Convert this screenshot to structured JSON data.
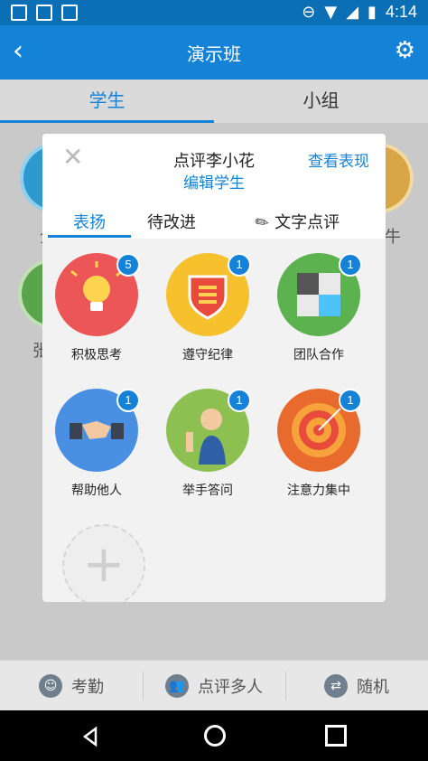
{
  "status_bar": {
    "time": "4:14",
    "icons": [
      "image-icon",
      "n-icon",
      "download-icon",
      "do-not-disturb-icon",
      "wifi-icon",
      "signal-icon",
      "battery-icon"
    ]
  },
  "app_bar": {
    "title": "演示班"
  },
  "tabs": [
    {
      "label": "学生"
    },
    {
      "label": "小组"
    }
  ],
  "background": {
    "partial_texts": [
      "全",
      "张",
      "牛"
    ]
  },
  "modal": {
    "student_title": "点评李小花",
    "edit_student": "编辑学生",
    "view_performance": "查看表现",
    "tabs": [
      {
        "label": "表扬"
      },
      {
        "label": "待改进"
      },
      {
        "label": "文字点评"
      }
    ],
    "items": [
      {
        "label": "积极思考",
        "badge": "5"
      },
      {
        "label": "遵守纪律",
        "badge": "1"
      },
      {
        "label": "团队合作",
        "badge": "1"
      },
      {
        "label": "帮助他人",
        "badge": "1"
      },
      {
        "label": "举手答问",
        "badge": "1"
      },
      {
        "label": "注意力集中",
        "badge": "1"
      }
    ],
    "add_symbol": "+"
  },
  "bottom_bar": {
    "attendance": "考勤",
    "review_multiple": "点评多人",
    "random": "随机"
  },
  "colors": {
    "primary": "#1483d7",
    "status_bar": "#0a6fb4",
    "red": "#ec5656",
    "yellow": "#f6c12c",
    "green": "#5cb24f",
    "blue": "#4a90e2",
    "lime": "#8cc152",
    "orange": "#e86a2c"
  }
}
